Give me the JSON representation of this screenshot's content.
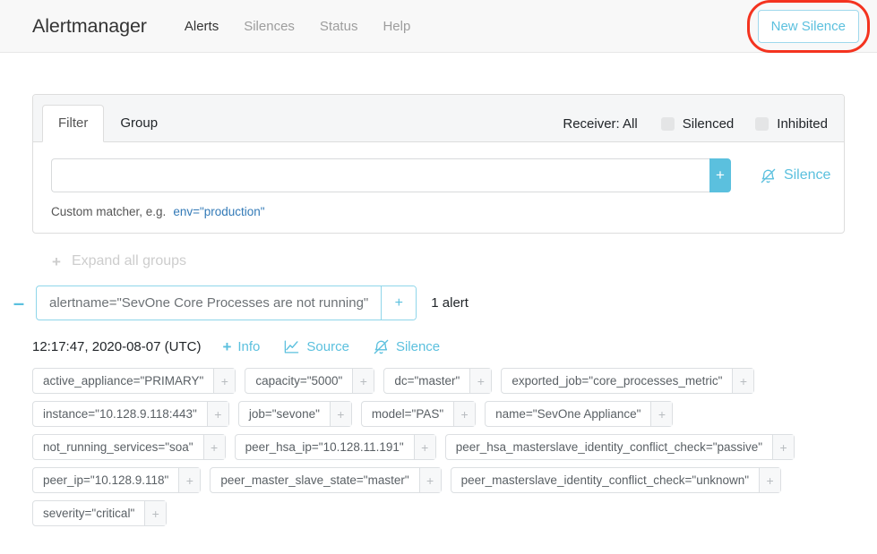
{
  "navbar": {
    "brand": "Alertmanager",
    "links": [
      {
        "label": "Alerts",
        "active": true
      },
      {
        "label": "Silences",
        "active": false
      },
      {
        "label": "Status",
        "active": false
      },
      {
        "label": "Help",
        "active": false
      }
    ],
    "new_silence_label": "New Silence",
    "annotation_color": "#f4331f",
    "accent_color": "#5bc0de"
  },
  "filter_card": {
    "tabs": [
      {
        "label": "Filter",
        "active": true
      },
      {
        "label": "Group",
        "active": false
      }
    ],
    "receiver_label": "Receiver: All",
    "toggles": [
      {
        "label": "Silenced",
        "checked": false
      },
      {
        "label": "Inhibited",
        "checked": false
      }
    ],
    "matcher_input_value": "",
    "matcher_input_placeholder": "",
    "add_button_label": "+",
    "silence_link_label": "Silence",
    "hint_prefix": "Custom matcher, e.g.",
    "hint_example": "env=\"production\""
  },
  "expand_all": {
    "label": "Expand all groups",
    "plus": "+"
  },
  "group": {
    "collapse_glyph": "–",
    "chip_label": "alertname=\"SevOne Core Processes are not running\"",
    "chip_plus": "+",
    "alert_count": "1 alert"
  },
  "alert": {
    "timestamp": "12:17:47, 2020-08-07 (UTC)",
    "actions": [
      {
        "label": "Info",
        "icon": "plus-icon"
      },
      {
        "label": "Source",
        "icon": "chart-line-icon"
      },
      {
        "label": "Silence",
        "icon": "bell-slash-icon"
      }
    ],
    "labels": [
      "active_appliance=\"PRIMARY\"",
      "capacity=\"5000\"",
      "dc=\"master\"",
      "exported_job=\"core_processes_metric\"",
      "instance=\"10.128.9.118:443\"",
      "job=\"sevone\"",
      "model=\"PAS\"",
      "name=\"SevOne Appliance\"",
      "not_running_services=\"soa\"",
      "peer_hsa_ip=\"10.128.11.191\"",
      "peer_hsa_masterslave_identity_conflict_check=\"passive\"",
      "peer_ip=\"10.128.9.118\"",
      "peer_master_slave_state=\"master\"",
      "peer_masterslave_identity_conflict_check=\"unknown\"",
      "severity=\"critical\""
    ],
    "label_plus": "+"
  }
}
